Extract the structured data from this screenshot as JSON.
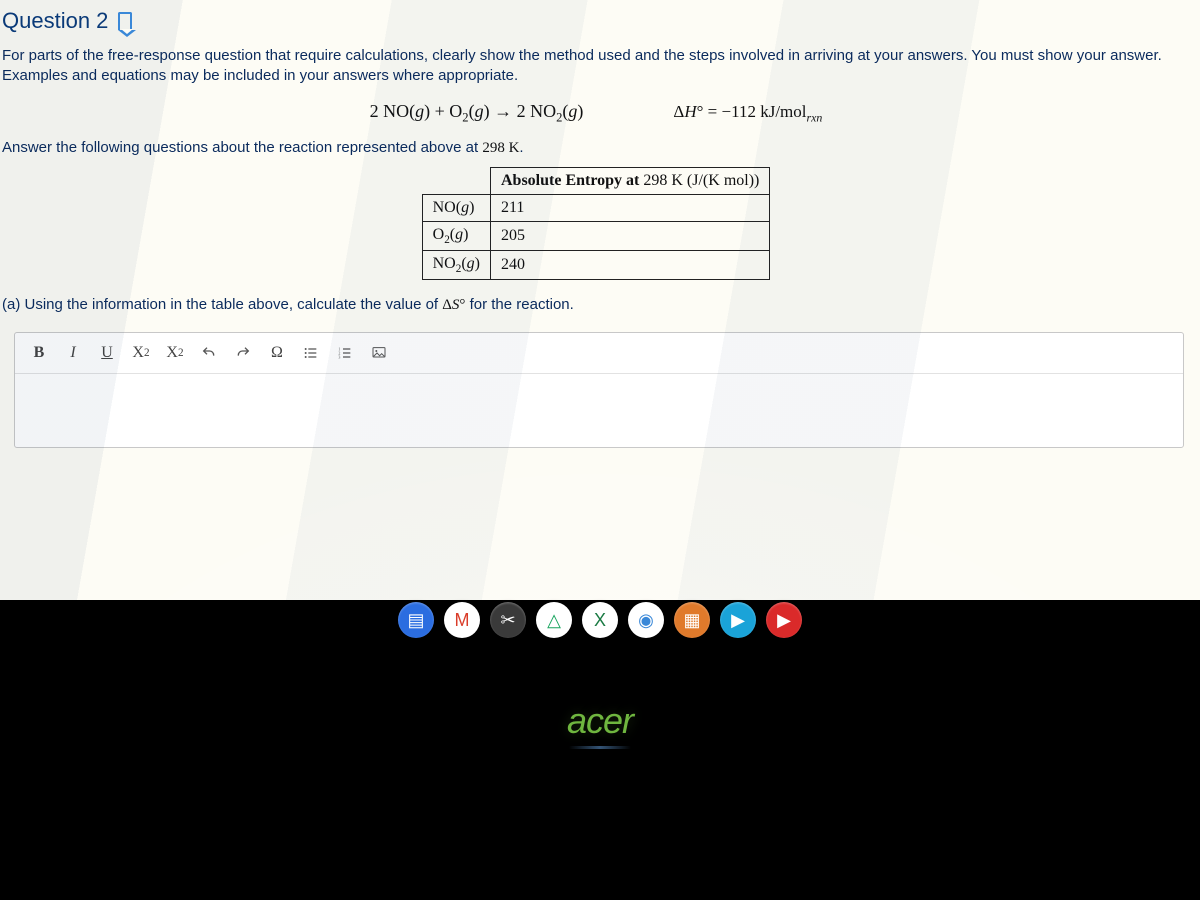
{
  "question": {
    "title": "Question 2",
    "instructions": "For parts of the free-response question that require calculations, clearly show the method used and the steps involved in arriving at your answers. You must show your answer. Examples and equations may be included in your answers where appropriate.",
    "reaction_html": "2 NO(<i>g</i>) + O<span class='sub'>2</span>(<i>g</i>) → 2 NO<span class='sub'>2</span>(<i>g</i>)",
    "delta_h_html": "Δ<i>H</i>° = −112 kJ/mol<span class='sub'><i>rxn</i></span>",
    "prompt2_html": "Answer the following questions about the reaction represented above at <span class='serif'>298 K</span>.",
    "table": {
      "header_html": "<span class='bold'>Absolute Entropy at</span> 298 K (J/(K mol))",
      "rows": [
        {
          "species_html": "NO(<i>g</i>)",
          "value": "211"
        },
        {
          "species_html": "O<span class='sub'>2</span>(<i>g</i>)",
          "value": "205"
        },
        {
          "species_html": "NO<span class='sub'>2</span>(<i>g</i>)",
          "value": "240"
        }
      ]
    },
    "part_a_html": "(a) Using the information in the table above, calculate the value of <span class='serif'>Δ<i>S</i>°</span> for the reaction."
  },
  "toolbar": {
    "bold": "B",
    "italic": "I",
    "underline": "U",
    "superscript_html": "X<span class='sup'>2</span>",
    "subscript_html": "X<span class='sub'>2</span>",
    "omega": "Ω"
  },
  "taskbar": {
    "icons": [
      {
        "name": "docs-icon",
        "bg": "#2b6de0",
        "glyph": "▤"
      },
      {
        "name": "gmail-icon",
        "bg": "#ffffff",
        "glyph": "M",
        "fg": "#da3d2a"
      },
      {
        "name": "snip-icon",
        "bg": "#3a3a3a",
        "glyph": "✂"
      },
      {
        "name": "drive-icon",
        "bg": "#ffffff",
        "glyph": "△",
        "fg": "#19a55f"
      },
      {
        "name": "excel-icon",
        "bg": "#ffffff",
        "glyph": "X",
        "fg": "#1a7a43"
      },
      {
        "name": "chrome-icon",
        "bg": "#ffffff",
        "glyph": "◉",
        "fg": "#3a88d8"
      },
      {
        "name": "calendar-icon",
        "bg": "#e07a2b",
        "glyph": "▦"
      },
      {
        "name": "play-icon",
        "bg": "#1aa3d8",
        "glyph": "▶"
      },
      {
        "name": "youtube-icon",
        "bg": "#da2a2a",
        "glyph": "▶"
      }
    ]
  },
  "brand": "acer",
  "chart_data": {
    "type": "table",
    "title": "Absolute Entropy at 298 K (J/(K mol))",
    "categories": [
      "NO(g)",
      "O2(g)",
      "NO2(g)"
    ],
    "values": [
      211,
      205,
      240
    ],
    "reaction": "2 NO(g) + O2(g) → 2 NO2(g)",
    "delta_H_kJ_per_mol_rxn": -112,
    "temperature_K": 298
  }
}
